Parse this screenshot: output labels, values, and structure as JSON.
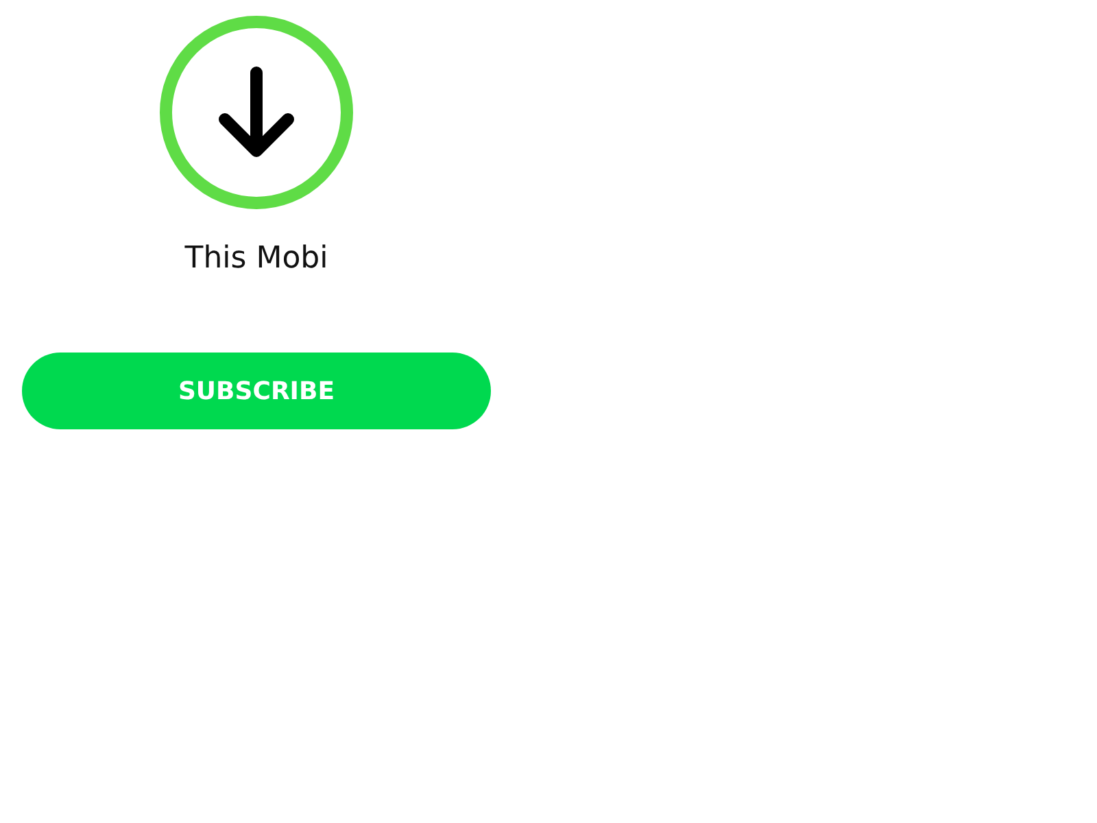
{
  "download": {
    "label": "This Mobi"
  },
  "subscribe_button": {
    "label": "SUBSCRIBE"
  }
}
